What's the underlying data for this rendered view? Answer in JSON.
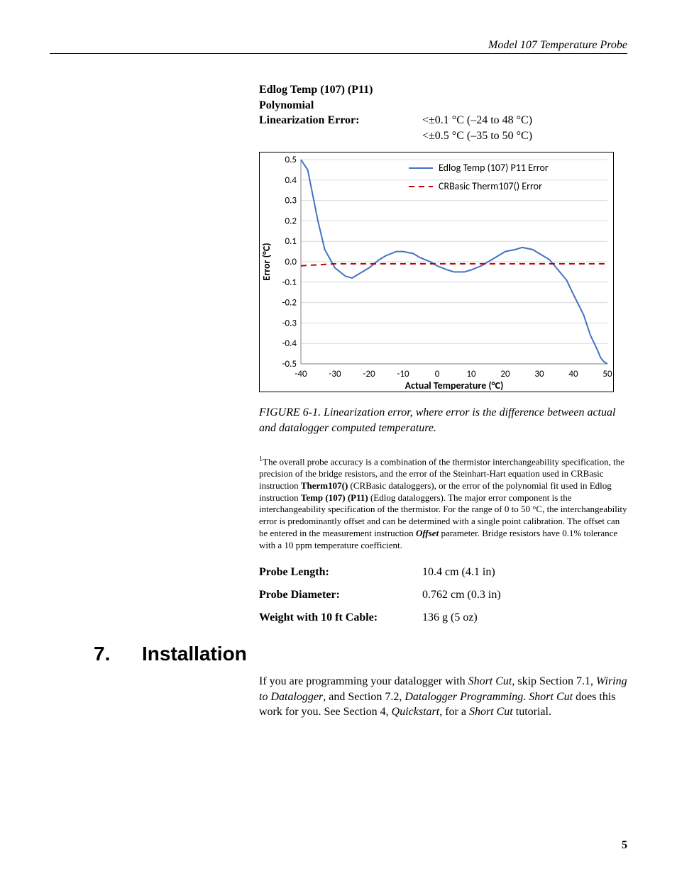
{
  "header": {
    "title": "Model 107 Temperature Probe"
  },
  "spec": {
    "title1": "Edlog Temp (107) (P11)",
    "title2": "Polynomial",
    "label": "Linearization Error:",
    "val1": "<±0.1 °C (–24 to 48 °C)",
    "val2": "<±0.5 °C (–35 to 50 °C)"
  },
  "chart_data": {
    "type": "line",
    "title": "",
    "xlabel": "Actual Temperature (°C)",
    "ylabel": "Error (°C)",
    "xlim": [
      -40,
      50
    ],
    "ylim": [
      -0.5,
      0.5
    ],
    "xticks": [
      -40,
      -30,
      -20,
      -10,
      0,
      10,
      20,
      30,
      40,
      50
    ],
    "yticks": [
      -0.5,
      -0.4,
      -0.3,
      -0.2,
      -0.1,
      0.0,
      0.1,
      0.2,
      0.3,
      0.4,
      0.5
    ],
    "legend": {
      "entries": [
        "Edlog Temp (107) P11 Error",
        "CRBasic Therm107() Error"
      ],
      "colors": [
        "#4472c4",
        "#c00000"
      ]
    },
    "series": [
      {
        "name": "Edlog Temp (107) P11 Error",
        "color": "#4472c4",
        "dash": "none",
        "x": [
          -40,
          -38,
          -35,
          -33,
          -30,
          -27,
          -25,
          -22,
          -20,
          -17,
          -15,
          -12,
          -10,
          -7,
          -5,
          -2,
          0,
          3,
          5,
          8,
          10,
          13,
          15,
          18,
          20,
          23,
          25,
          28,
          30,
          33,
          35,
          38,
          40,
          43,
          45,
          47,
          48,
          49,
          50
        ],
        "y": [
          0.5,
          0.45,
          0.2,
          0.06,
          -0.03,
          -0.07,
          -0.08,
          -0.05,
          -0.03,
          0.01,
          0.03,
          0.05,
          0.05,
          0.04,
          0.02,
          0.0,
          -0.02,
          -0.04,
          -0.05,
          -0.05,
          -0.04,
          -0.02,
          0.0,
          0.03,
          0.05,
          0.06,
          0.07,
          0.06,
          0.04,
          0.01,
          -0.03,
          -0.09,
          -0.16,
          -0.26,
          -0.36,
          -0.43,
          -0.47,
          -0.49,
          -0.5
        ]
      },
      {
        "name": "CRBasic Therm107() Error",
        "color": "#c00000",
        "dash": "8 6",
        "x": [
          -40,
          -30,
          -20,
          -10,
          0,
          10,
          20,
          30,
          40,
          50
        ],
        "y": [
          -0.02,
          -0.01,
          -0.01,
          -0.01,
          -0.01,
          -0.01,
          -0.01,
          -0.01,
          -0.01,
          -0.01
        ]
      }
    ]
  },
  "figure": {
    "label": "FIGURE 6-1.  Linearization error, where error is the difference between actual and datalogger computed temperature."
  },
  "footnote": {
    "text": "The overall probe accuracy is a combination of the thermistor interchangeability specification, the precision of the bridge resistors, and the error of the Steinhart-Hart equation used in CRBasic instruction ",
    "b1": "Therm107()",
    "mid1": " (CRBasic dataloggers), or the error of the polynomial fit used in Edlog instruction ",
    "b2": "Temp (107) (P11)",
    "mid2": " (Edlog dataloggers).  The major error component is the interchangeability specification of the thermistor.  For the range of 0 to 50 °C, the interchangeability error is predominantly offset and can be determined with a single point calibration.  The offset can be entered in the measurement instruction ",
    "b3": "Offset",
    "end": " parameter.  Bridge resistors have 0.1% tolerance with a 10 ppm temperature coefficient."
  },
  "dims": {
    "rows": [
      {
        "label": "Probe Length:",
        "value": "10.4 cm (4.1 in)"
      },
      {
        "label": "Probe Diameter:",
        "value": "0.762 cm (0.3 in)"
      },
      {
        "label": "Weight with 10 ft Cable:",
        "value": "136 g (5 oz)"
      }
    ]
  },
  "section": {
    "num": "7.",
    "title": "Installation"
  },
  "para": {
    "p1a": "If you are programming your datalogger with ",
    "i1": "Short Cut",
    "p1b": ", skip Section 7.1, ",
    "i2": "Wiring to Datalogger",
    "p1c": ", and Section 7.2, ",
    "i3": "Datalogger Programming",
    "p1d": ".  ",
    "i4": "Short Cut",
    "p1e": " does this work for you.  See Section 4, ",
    "i5": "Quickstart",
    "p1f": ", for a ",
    "i6": "Short Cut",
    "p1g": " tutorial."
  },
  "page_number": "5"
}
